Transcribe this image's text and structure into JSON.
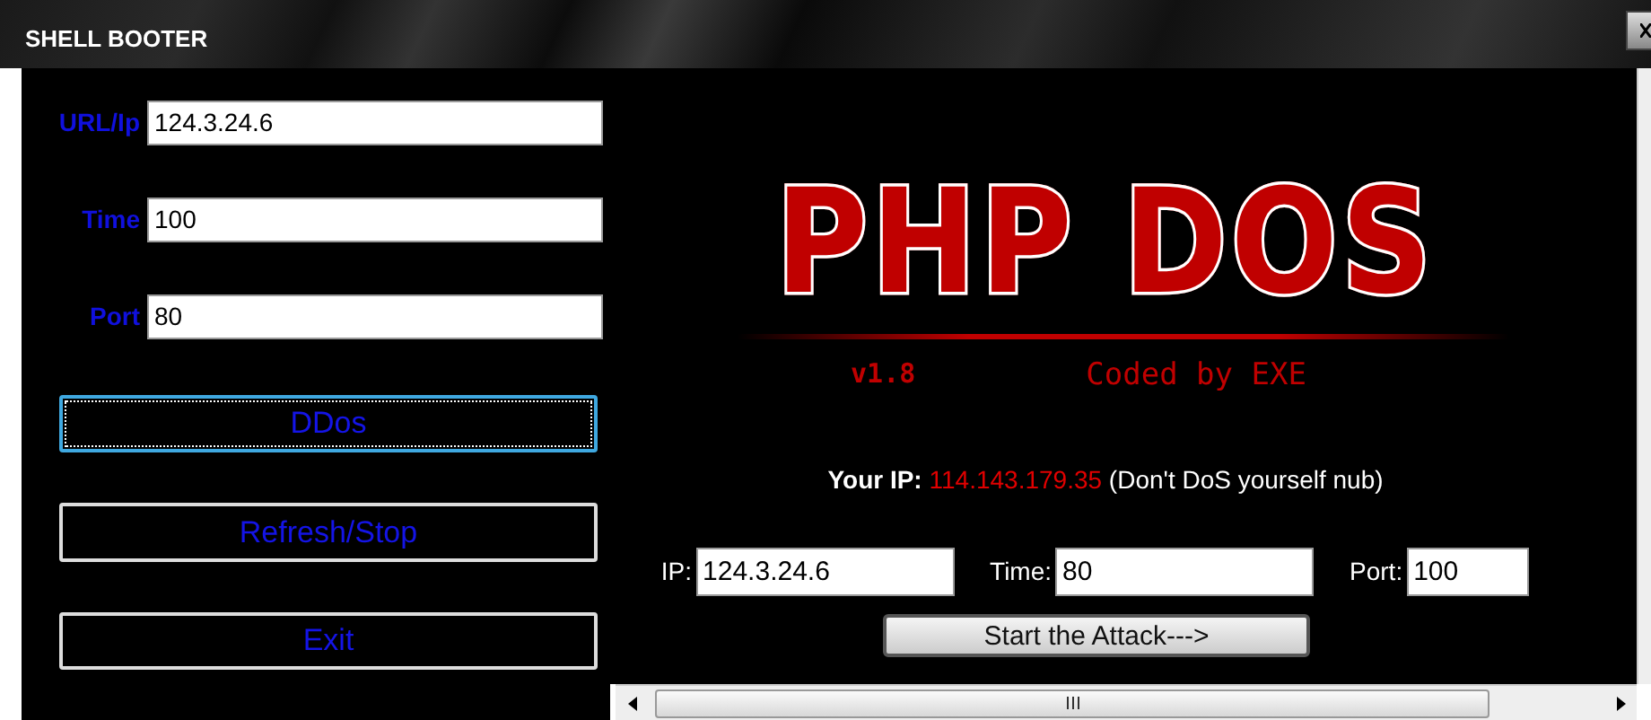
{
  "window": {
    "title": "SHELL BOOTER"
  },
  "form": {
    "fields": [
      {
        "label": "URL/Ip",
        "value": "124.3.24.6"
      },
      {
        "label": "Time",
        "value": "100"
      },
      {
        "label": "Port",
        "value": "80"
      }
    ]
  },
  "buttons": [
    {
      "label": "DDos",
      "focused": true
    },
    {
      "label": "Refresh/Stop",
      "focused": false
    },
    {
      "label": "Exit",
      "focused": false
    }
  ],
  "web_panel": {
    "logo": "PHP DOS",
    "version": "v1.8",
    "credit": "Coded by EXE",
    "ip_notice": {
      "label": "Your IP:",
      "ip": "114.143.179.35",
      "note": "(Don't DoS yourself nub)"
    },
    "fields": [
      {
        "label": "IP:",
        "value": "124.3.24.6"
      },
      {
        "label": "Time:",
        "value": "80"
      },
      {
        "label": "Port:",
        "value": "100"
      }
    ],
    "button": "Start the Attack--->"
  }
}
